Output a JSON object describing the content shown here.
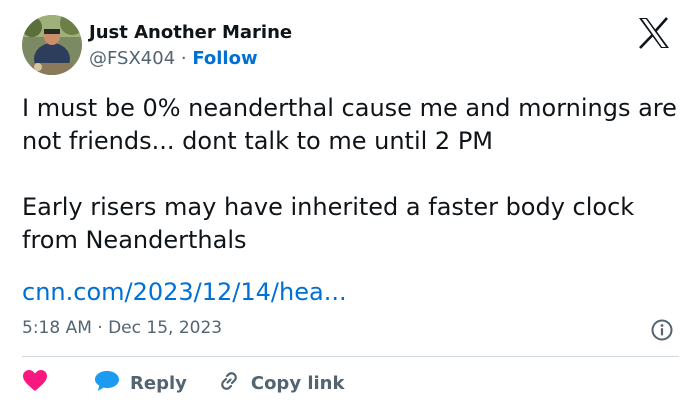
{
  "user": {
    "display_name": "Just Another Marine",
    "handle": "@FSX404",
    "separator": " · ",
    "follow_label": "Follow"
  },
  "tweet": {
    "paragraphs": [
      "I must be 0% neanderthal cause me and mornings are not friends... dont talk to me until 2 PM",
      "Early risers may have inherited a faster body clock from Neanderthals"
    ],
    "link_text": "cnn.com/2023/12/14/hea...",
    "timestamp": "5:18 AM · Dec 15, 2023"
  },
  "actions": {
    "reply_label": "Reply",
    "copy_link_label": "Copy link"
  },
  "icons": {
    "brand": "x-logo",
    "like": "heart-icon",
    "reply": "speech-bubble-icon",
    "copy": "link-icon",
    "info": "info-icon"
  },
  "colors": {
    "link": "#006fd6",
    "secondary_text": "#536471",
    "like": "#f91880",
    "reply": "#1d9bf0",
    "divider": "#cfd9de"
  }
}
